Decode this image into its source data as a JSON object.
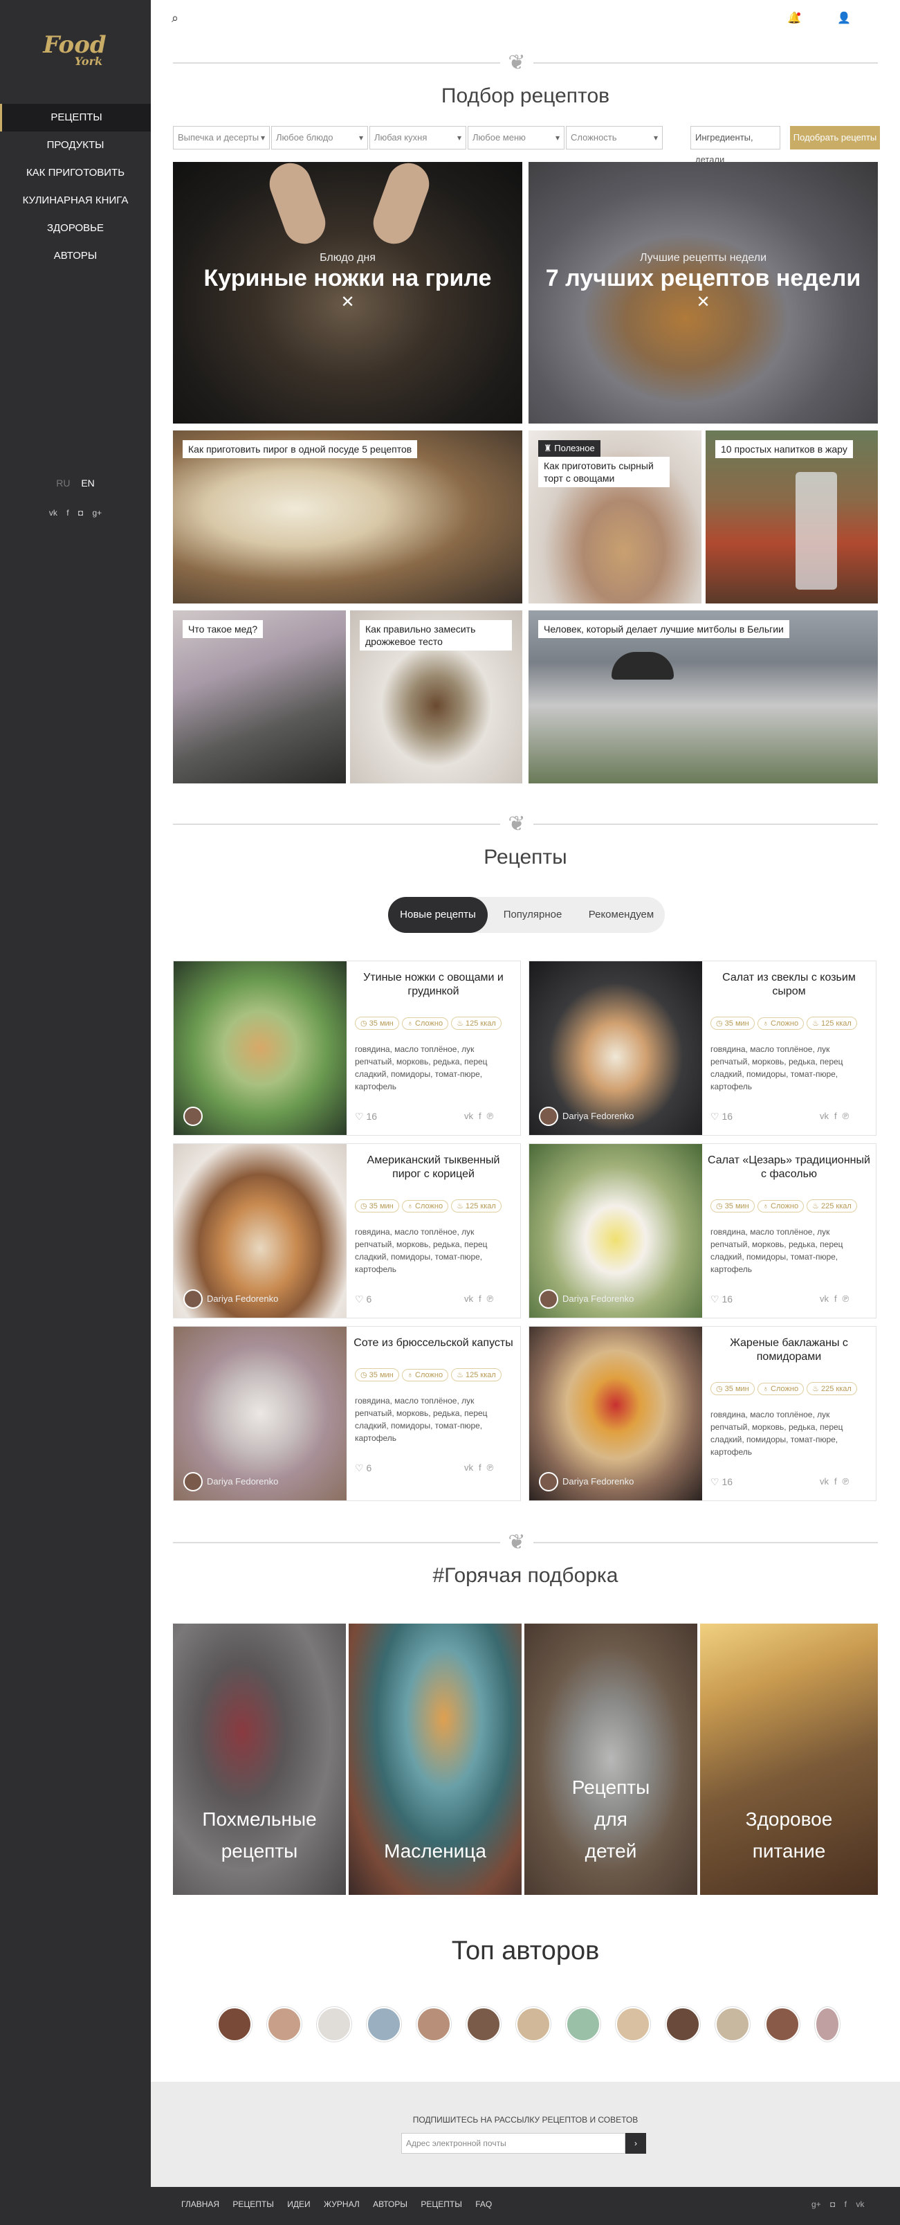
{
  "sidebar": {
    "logo": {
      "line1": "Food",
      "line2": "York"
    },
    "items": [
      {
        "label": "Рецепты"
      },
      {
        "label": "Продукты"
      },
      {
        "label": "Как приготовить"
      },
      {
        "label": "Кулинарная книга"
      },
      {
        "label": "Здоровье"
      },
      {
        "label": "Авторы"
      }
    ],
    "lang": {
      "ru": "RU",
      "en": "EN"
    },
    "social": [
      "vk-icon",
      "facebook-icon",
      "instagram-icon",
      "google-plus-icon"
    ]
  },
  "selection": {
    "title": "Подбор рецептов",
    "filters": [
      "Выпечка и десерты",
      "Любое блюдо",
      "Любая кухня",
      "Любое меню",
      "Сложность"
    ],
    "ingredients_value": "Ингредиенты, детали",
    "submit_label": "Подобрать рецепты"
  },
  "featured": {
    "big": [
      {
        "kicker": "Блюдо дня",
        "title": "Куриные ножки на гриле"
      },
      {
        "kicker": "Лучшие рецепты недели",
        "title": "7 лучших рецептов недели"
      }
    ],
    "tiles": [
      {
        "label": "Как приготовить пирог в одной посуде 5 рецептов"
      },
      {
        "tag": "Полезное",
        "label": "Как приготовить сырный торт с овощами"
      },
      {
        "label": "10 простых напитков в жару"
      },
      {
        "label": "Что такое мед?"
      },
      {
        "label": "Как правильно замесить дрожжевое тесто"
      },
      {
        "label": "Человек, который делает лучшие митболы в Бельгии"
      }
    ]
  },
  "recipes": {
    "title": "Рецепты",
    "tabs": [
      {
        "label": "Новые рецепты"
      },
      {
        "label": "Популярное"
      },
      {
        "label": "Рекомендуем"
      }
    ],
    "cards": [
      {
        "title": "Утиные ножки с овощами и грудинкой",
        "time": "35 мин",
        "level": "Сложно",
        "kcal": "125 ккал",
        "ingredients": "говядина, масло топлёное, лук репчатый, морковь, редька, перец сладкий, помидоры, томат-пюре, картофель",
        "likes": "16",
        "author": ""
      },
      {
        "title": "Салат из свеклы с козьим сыром",
        "time": "35 мин",
        "level": "Сложно",
        "kcal": "125 ккал",
        "ingredients": "говядина, масло топлёное, лук репчатый, морковь, редька, перец сладкий, помидоры, томат-пюре, картофель",
        "likes": "16",
        "author": "Dariya Fedorenko"
      },
      {
        "title": "Американский тыквенный пирог с корицей",
        "time": "35 мин",
        "level": "Сложно",
        "kcal": "125 ккал",
        "ingredients": "говядина, масло топлёное, лук репчатый, морковь, редька, перец сладкий, помидоры, томат-пюре, картофель",
        "likes": "6",
        "author": "Dariya Fedorenko"
      },
      {
        "title": "Салат «Цезарь» традиционный с фасолью",
        "time": "35 мин",
        "level": "Сложно",
        "kcal": "225 ккал",
        "ingredients": "говядина, масло топлёное, лук репчатый, морковь, редька, перец сладкий, помидоры, томат-пюре, картофель",
        "likes": "16",
        "author": "Dariya Fedorenko"
      },
      {
        "title": "Соте из брюссельской капусты",
        "time": "35 мин",
        "level": "Сложно",
        "kcal": "125 ккал",
        "ingredients": "говядина, масло топлёное, лук репчатый, морковь, редька, перец сладкий, помидоры, томат-пюре, картофель",
        "likes": "6",
        "author": "Dariya Fedorenko"
      },
      {
        "title": "Жареные баклажаны с помидорами",
        "time": "35 мин",
        "level": "Сложно",
        "kcal": "225 ккал",
        "ingredients": "говядина, масло топлёное, лук репчатый, морковь, редька, перец сладкий, помидоры, томат-пюре, картофель",
        "likes": "16",
        "author": "Dariya Fedorenko"
      }
    ]
  },
  "hot": {
    "title": "#Горячая подборка",
    "items": [
      {
        "l1": "Похмельные",
        "l2": "рецепты"
      },
      {
        "l1": "Масленица",
        "l2": ""
      },
      {
        "l1": "Рецепты",
        "l2": "для",
        "l3": "детей"
      },
      {
        "l1": "Здоровое",
        "l2": "питание"
      }
    ]
  },
  "authors": {
    "title": "Топ авторов"
  },
  "subscribe": {
    "title": "Подпишитесь на рассылку рецептов и советов",
    "placeholder": "Адрес электронной почты",
    "button": "›"
  },
  "footer": {
    "links": [
      {
        "label": "Главная"
      },
      {
        "label": "Рецепты"
      },
      {
        "label": "Идеи"
      },
      {
        "label": "Журнал"
      },
      {
        "label": "Авторы"
      },
      {
        "label": "Рецепты"
      },
      {
        "label": "FAQ"
      }
    ]
  },
  "colors": {
    "accent": "#c9ac66",
    "sidebar": "#2e2e30"
  }
}
